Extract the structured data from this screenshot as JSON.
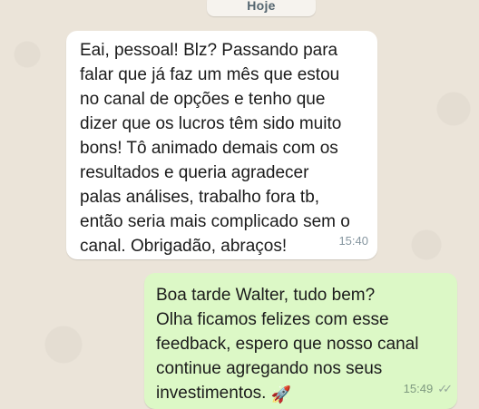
{
  "chat": {
    "date_label": "Hoje",
    "incoming": {
      "text": "Eai, pessoal! Blz? Passando para\nfalar que já faz um mês que estou\nno canal de opções e tenho que\ndizer que os lucros têm sido muito\nbons! Tô animado demais com os\nresultados e queria agradecer\npalas análises, trabalho fora tb,\nentão seria mais complicado sem o\ncanal. Obrigadão, abraços!",
      "time": "15:40"
    },
    "outgoing": {
      "text": "Boa tarde Walter, tudo bem?\nOlha ficamos felizes com esse\nfeedback, espero que nosso canal\ncontinue agregando nos seus\ninvestimentos. ",
      "emoji": "🚀",
      "emoji_name": "rocket-icon",
      "time": "15:49",
      "status": "double-tick-icon"
    }
  },
  "colors": {
    "wallpaper": "#ebe4d9",
    "incoming_bubble": "#ffffff",
    "outgoing_bubble": "#dcf8c6",
    "timestamp": "#8696a0"
  }
}
